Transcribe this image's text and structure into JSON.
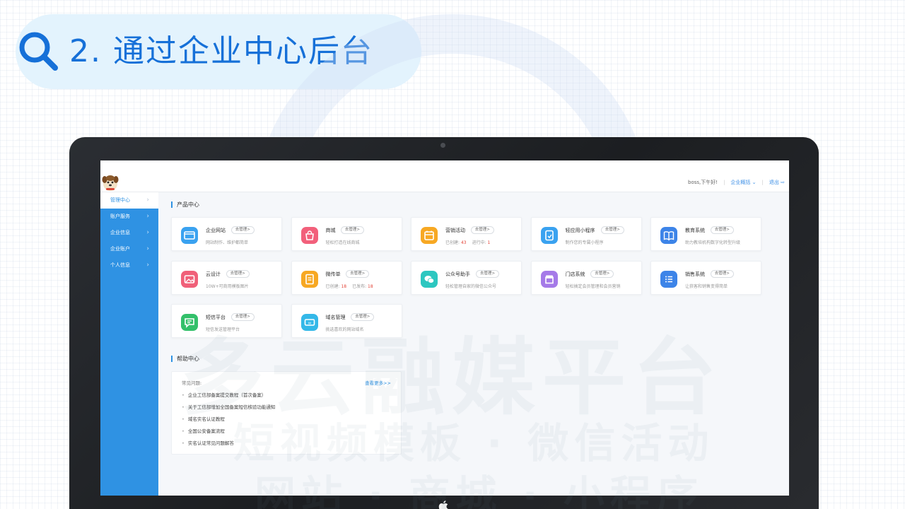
{
  "slide": {
    "title": "2. 通过企业中心后台"
  },
  "watermark": {
    "line1": "多云融媒平台",
    "line2": "短视频模板 · 微信活动",
    "line3": "网站 · 商城 · 小程序"
  },
  "topbar": {
    "greeting": "boss,下午好!",
    "overview": "企业概括",
    "logout": "退出"
  },
  "sidebar": {
    "items": [
      {
        "label": "管理中心",
        "active": true
      },
      {
        "label": "账户服务",
        "active": false
      },
      {
        "label": "企业信息",
        "active": false
      },
      {
        "label": "企业账户",
        "active": false
      },
      {
        "label": "个人信息",
        "active": false
      }
    ]
  },
  "product_center": {
    "title": "产品中心",
    "manage_label": "去管理>",
    "cards": [
      {
        "name": "企业网站",
        "desc": "网站制作、维护都简单",
        "color": "#3aa2f0",
        "icon": "website-icon"
      },
      {
        "name": "商城",
        "desc": "轻松打造在线商城",
        "color": "#f2607b",
        "icon": "shop-bag-icon"
      },
      {
        "name": "营销活动",
        "desc": "",
        "created_label": "已创建:",
        "created": "43",
        "running_label": "进行中:",
        "running": "1",
        "color": "#f7a823",
        "icon": "calendar-icon"
      },
      {
        "name": "轻应用小程序",
        "desc": "制作您的专属小程序",
        "color": "#3aa2f0",
        "icon": "mini-program-icon"
      },
      {
        "name": "教育系统",
        "desc": "助力教培机构数字化转型升级",
        "color": "#3d84e8",
        "icon": "book-icon"
      },
      {
        "name": "云设计",
        "desc": "10W+可商用模板图片",
        "color": "#f06079",
        "icon": "image-icon"
      },
      {
        "name": "微传单",
        "desc": "",
        "created_label": "已创建:",
        "created": "18",
        "running_label": "已发布:",
        "running": "18",
        "color": "#f7a823",
        "icon": "flyer-icon"
      },
      {
        "name": "公众号助手",
        "desc": "轻松管理自家的微信公众号",
        "color": "#2cc7c0",
        "icon": "wechat-icon"
      },
      {
        "name": "门店系统",
        "desc": "轻松搞定会员管理和会员营销",
        "color": "#a57ae8",
        "icon": "store-icon"
      },
      {
        "name": "销售系统",
        "desc": "让获客和销售变得简单",
        "color": "#3d84e8",
        "icon": "list-icon"
      },
      {
        "name": "短信平台",
        "desc": "短信发送管理平台",
        "color": "#33c06a",
        "icon": "sms-icon"
      },
      {
        "name": "域名管理",
        "desc": "挑选喜欢的网站域名",
        "color": "#34b8e8",
        "icon": "domain-icon"
      }
    ]
  },
  "help_center": {
    "title": "帮助中心",
    "faq_label": "常见问题:",
    "view_more": "查看更多>>",
    "items": [
      "企业工信部备案提交教程（首次备案）",
      "关于工信部增加全国备案短信核验功能通知",
      "域名实名认证教程",
      "全国公安备案流程",
      "实名认证常见问题解答"
    ]
  }
}
